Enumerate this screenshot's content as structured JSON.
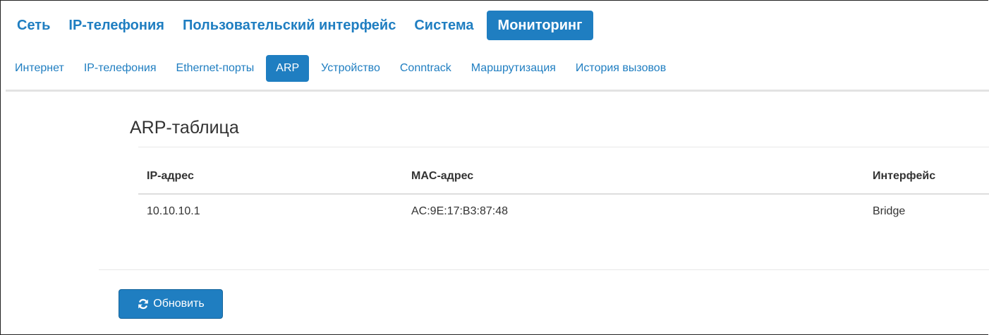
{
  "main_nav": {
    "items": [
      {
        "label": "Сеть"
      },
      {
        "label": "IP-телефония"
      },
      {
        "label": "Пользовательский интерфейс"
      },
      {
        "label": "Система"
      },
      {
        "label": "Мониторинг",
        "active": true
      }
    ]
  },
  "sub_nav": {
    "items": [
      {
        "label": "Интернет"
      },
      {
        "label": "IP-телефония"
      },
      {
        "label": "Ethernet-порты"
      },
      {
        "label": "ARP",
        "active": true
      },
      {
        "label": "Устройство"
      },
      {
        "label": "Conntrack"
      },
      {
        "label": "Маршрутизация"
      },
      {
        "label": "История вызовов"
      }
    ]
  },
  "panel": {
    "title": "ARP-таблица",
    "table": {
      "headers": {
        "ip": "IP-адрес",
        "mac": "MAC-адрес",
        "interface": "Интерфейс"
      },
      "rows": [
        {
          "ip": "10.10.10.1",
          "mac": "AC:9E:17:B3:87:48",
          "interface": "Bridge"
        }
      ]
    },
    "refresh_button": {
      "label": "Обновить",
      "icon": "refresh-icon"
    }
  },
  "colors": {
    "accent": "#1f7ec1",
    "text": "#333333",
    "divider": "#e3e3e3"
  }
}
